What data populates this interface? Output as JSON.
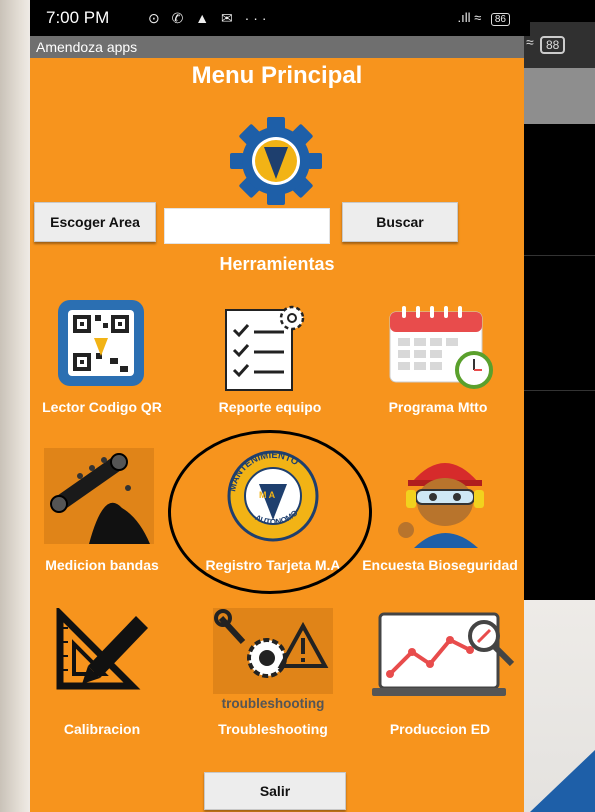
{
  "status_bar": {
    "time": "7:00 PM",
    "notif_icons": "⊙ ✆ ▲ ✉ ···",
    "signal": ".ıll ≈",
    "battery": "86"
  },
  "background_phone": {
    "battery": "88"
  },
  "app": {
    "title": "Amendoza apps",
    "menu_title": "Menu Principal"
  },
  "search": {
    "area_button": "Escoger Area",
    "input_value": "",
    "input_placeholder": "",
    "search_button": "Buscar"
  },
  "tools_heading": "Herramientas",
  "tools": [
    {
      "label": "Lector Codigo QR",
      "icon": "qr-code-icon"
    },
    {
      "label": "Reporte equipo",
      "icon": "checklist-icon"
    },
    {
      "label": "Programa Mtto",
      "icon": "calendar-icon"
    },
    {
      "label": "Medicion bandas",
      "icon": "conveyor-belt-icon"
    },
    {
      "label": "Registro Tarjeta M.A",
      "icon": "mantenimiento-autonomo-logo"
    },
    {
      "label": "Encuesta Bioseguridad",
      "icon": "safety-worker-icon"
    },
    {
      "label": "Calibracion",
      "icon": "ruler-pencil-icon"
    },
    {
      "label": "Troubleshooting",
      "icon": "troubleshooting-icon"
    },
    {
      "label": "Produccion ED",
      "icon": "monitor-chart-icon"
    }
  ],
  "troubleshooting_caption": "troubleshooting",
  "ma_logo": {
    "top_text": "MANTENIMIENTO",
    "bottom_text": "AUTÓNOMO",
    "center_text": "M A"
  },
  "exit_button": "Salir",
  "colors": {
    "app_bg": "#f7941d",
    "title_bar": "#6f6f6f",
    "button_bg": "#ededed",
    "gear_blue": "#1e5fa8",
    "ma_gold": "#f2b315"
  }
}
